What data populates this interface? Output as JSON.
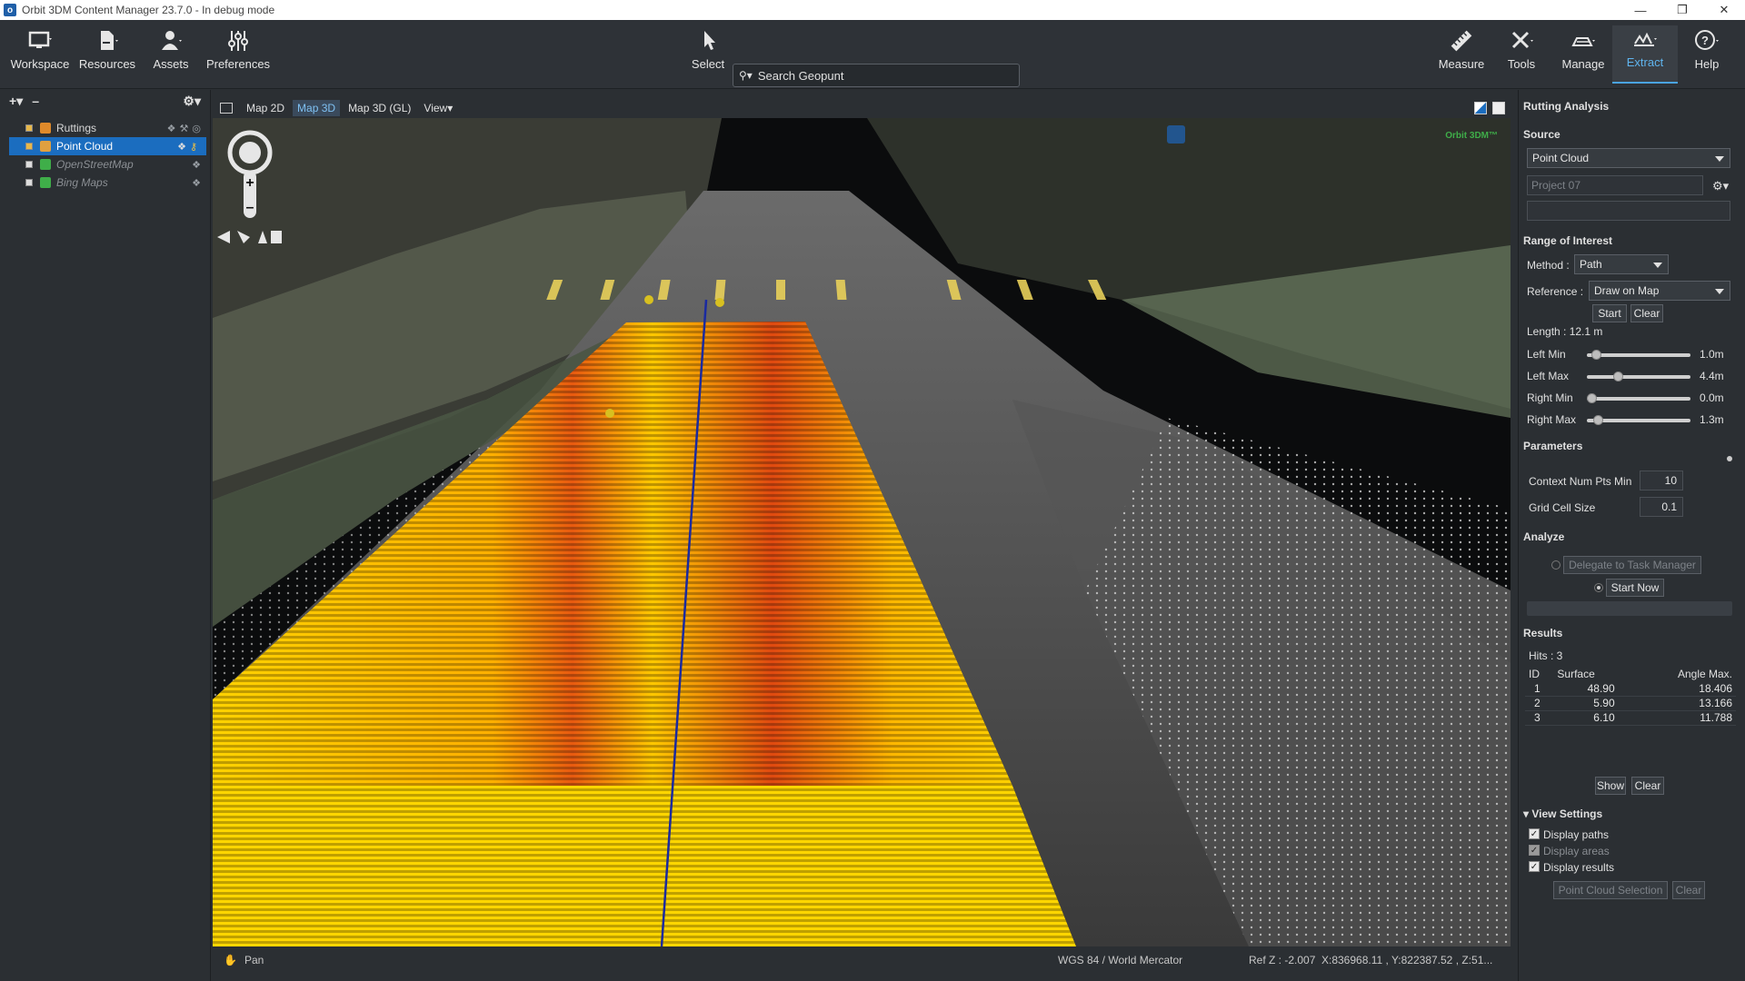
{
  "window": {
    "title": "Orbit 3DM Content Manager 23.7.0 - In debug mode",
    "app_icon": "orbit-app-icon"
  },
  "toolbar": {
    "left": [
      {
        "label": "Workspace",
        "icon": "monitor-icon"
      },
      {
        "label": "Resources",
        "icon": "resources-icon"
      },
      {
        "label": "Assets",
        "icon": "user-assets-icon"
      },
      {
        "label": "Preferences",
        "icon": "sliders-icon"
      }
    ],
    "select_label": "Select",
    "search_placeholder": "Search Geopunt",
    "right": [
      {
        "label": "Measure",
        "icon": "ruler-icon"
      },
      {
        "label": "Tools",
        "icon": "tools-icon"
      },
      {
        "label": "Manage",
        "icon": "manage-icon"
      },
      {
        "label": "Extract",
        "icon": "extract-icon",
        "active": true
      },
      {
        "label": "Help",
        "icon": "help-icon"
      }
    ]
  },
  "layers": [
    {
      "name": "Ruttings",
      "selected": false,
      "dim": false,
      "color": "#e08a2a"
    },
    {
      "name": "Point Cloud",
      "selected": true,
      "dim": false,
      "color": "#e0a040"
    },
    {
      "name": "OpenStreetMap",
      "selected": false,
      "dim": true,
      "color": "#3fae49"
    },
    {
      "name": "Bing Maps",
      "selected": false,
      "dim": true,
      "color": "#3fae49"
    }
  ],
  "viewport": {
    "tabs": [
      {
        "label": "Map 2D",
        "active": false
      },
      {
        "label": "Map 3D",
        "active": true
      },
      {
        "label": "Map 3D (GL)",
        "active": false
      },
      {
        "label": "View",
        "active": false
      }
    ],
    "watermark": "Orbit 3DM™"
  },
  "status": {
    "mode": "Pan",
    "crs": "WGS 84 / World Mercator",
    "refz": "Ref Z : -2.007",
    "coords": "X:836968.11 , Y:822387.52 , Z:51..."
  },
  "panel": {
    "title": "Rutting Analysis",
    "source_header": "Source",
    "source_value": "Point Cloud",
    "project_placeholder": "Project 07",
    "roi_header": "Range of Interest",
    "method_label": "Method :",
    "method_value": "Path",
    "reference_label": "Reference :",
    "reference_value": "Draw on Map",
    "start_label": "Start",
    "clear_label": "Clear",
    "length": "Length : 12.1 m",
    "sliders": [
      {
        "label": "Left Min",
        "value": "1.0m",
        "fraction": 0.05
      },
      {
        "label": "Left Max",
        "value": "4.4m",
        "fraction": 0.28
      },
      {
        "label": "Right Min",
        "value": "0.0m",
        "fraction": 0.0
      },
      {
        "label": "Right Max",
        "value": "1.3m",
        "fraction": 0.07
      }
    ],
    "params_header": "Parameters",
    "ctx_label": "Context Num Pts Min",
    "ctx_value": "10",
    "grid_label": "Grid Cell Size",
    "grid_value": "0.1",
    "analyze_header": "Analyze",
    "delegate_label": "Delegate to Task Manager",
    "startnow_label": "Start Now",
    "results_header": "Results",
    "hits": "Hits : 3",
    "results_cols": [
      "ID",
      "Surface",
      "Angle Max."
    ],
    "results_rows": [
      [
        "1",
        "48.90",
        "18.406"
      ],
      [
        "2",
        "5.90",
        "13.166"
      ],
      [
        "3",
        "6.10",
        "11.788"
      ]
    ],
    "show_label": "Show",
    "clear2_label": "Clear",
    "view_settings_header": "View Settings",
    "display_paths": "Display paths",
    "display_areas": "Display areas",
    "display_results": "Display results",
    "pc_selection_label": "Point Cloud Selection",
    "clear3_label": "Clear"
  }
}
